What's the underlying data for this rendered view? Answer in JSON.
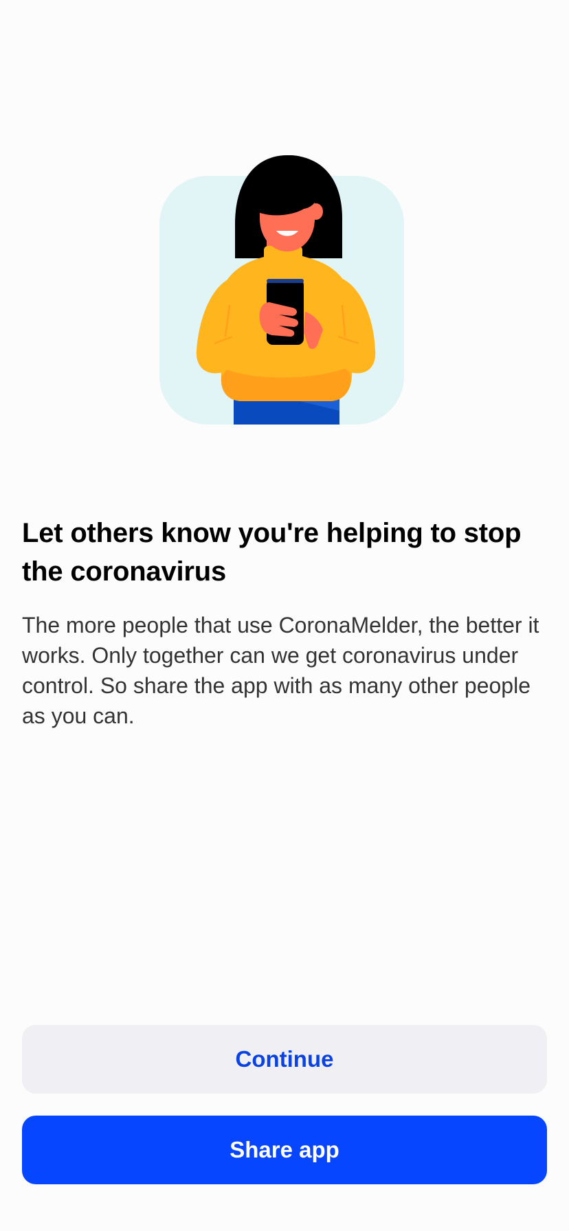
{
  "illustration": {
    "icon": "woman-holding-phone-illustration",
    "colors": {
      "background_tile": "#e1f4f6",
      "hair": "#000000",
      "skin": "#ff6f55",
      "sweater": "#ffb51d",
      "sweater_shade": "#ff9f1a",
      "pants": "#0a4abf",
      "phone": "#000000",
      "phone_edge": "#1c3c8c"
    }
  },
  "headline": "Let others know you're helping to stop the coronavirus",
  "body": "The more people that use CoronaMelder, the better it works. Only together can we get coronavirus under control. So share the app with as many other people as you can.",
  "buttons": {
    "continue_label": "Continue",
    "share_label": "Share app"
  },
  "colors": {
    "accent": "#0646ff",
    "secondary_button_bg": "#efeff4",
    "secondary_button_text": "#0b43e0",
    "body_text": "#333333"
  }
}
